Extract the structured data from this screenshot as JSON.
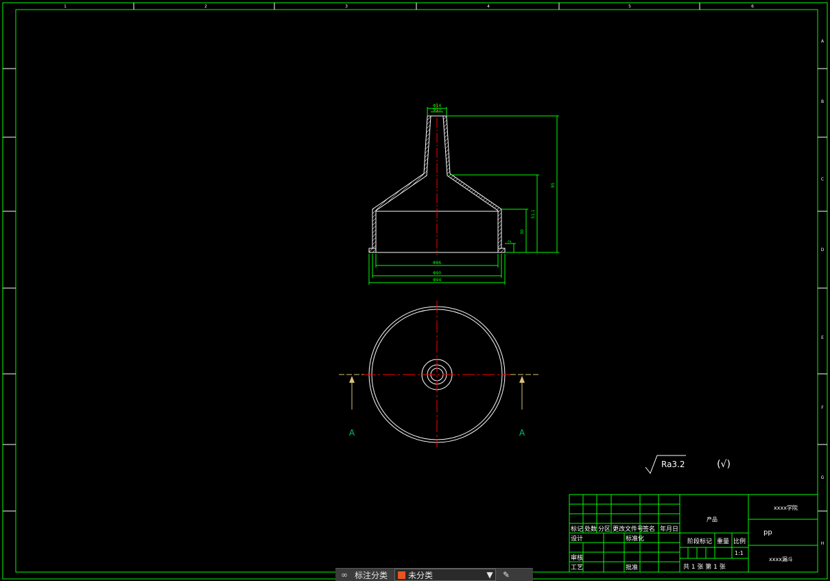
{
  "colors": {
    "border": "#00ff00",
    "geometry": "#ffffff",
    "centerline": "#ff0000",
    "dimension": "#00ff00",
    "section_marker": "#d8c27a",
    "title_block": "#00ff00",
    "text": "#ffffff",
    "toolbar_bg": "#3b3b3b",
    "classification_swatch": "#e8551e"
  },
  "frame": {
    "top_zones": [
      "1",
      "2",
      "3",
      "4",
      "5",
      "6"
    ],
    "side_zones": [
      "A",
      "B",
      "C",
      "D",
      "E",
      "F",
      "G",
      "H"
    ]
  },
  "dimensions": {
    "top_dia_outer": "Φ14",
    "top_dia_inner": "Φ10",
    "height_total": "95",
    "height_cone": "51.1",
    "height_body": "30",
    "height_lip": "2",
    "dia_86": "Φ86",
    "dia_90": "Φ90",
    "dia_94": "Φ94"
  },
  "section": {
    "left_label": "A",
    "right_label": "A"
  },
  "surface": {
    "roughness": "Ra3.2",
    "general_mark": "(√)"
  },
  "title_block": {
    "header_cols": [
      "标记",
      "处数",
      "分区",
      "更改文件号",
      "签名",
      "年月日"
    ],
    "row_labels": [
      "设计",
      "审核",
      "工艺"
    ],
    "standardization": "标准化",
    "approve": "批准",
    "product_label": "产品",
    "stage_mark": "阶段标记",
    "weight": "重量",
    "scale": "比例",
    "scale_value": "1:1",
    "sheets": "共 1  张  第 1  张",
    "company": "xxxx学院",
    "material": "pp",
    "drawing_name": "xxxx漏斗"
  },
  "toolbar": {
    "annotate_label": "标注分类",
    "classification_value": "未分类"
  }
}
